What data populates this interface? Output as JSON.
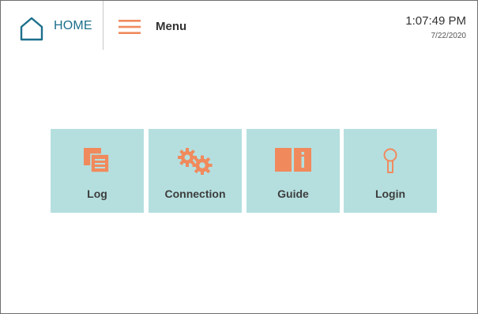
{
  "header": {
    "home_label": "HOME",
    "menu_label": "Menu",
    "time": "1:07:49 PM",
    "date": "7/22/2020"
  },
  "tiles": [
    {
      "label": "Log",
      "icon": "log-icon"
    },
    {
      "label": "Connection",
      "icon": "gears-icon"
    },
    {
      "label": "Guide",
      "icon": "guide-book-icon"
    },
    {
      "label": "Login",
      "icon": "key-icon"
    }
  ],
  "colors": {
    "accent_orange": "#f08a5d",
    "tile_background": "#b5dfdf",
    "home_blue": "#1c6f8a",
    "text_dark": "#333333"
  }
}
